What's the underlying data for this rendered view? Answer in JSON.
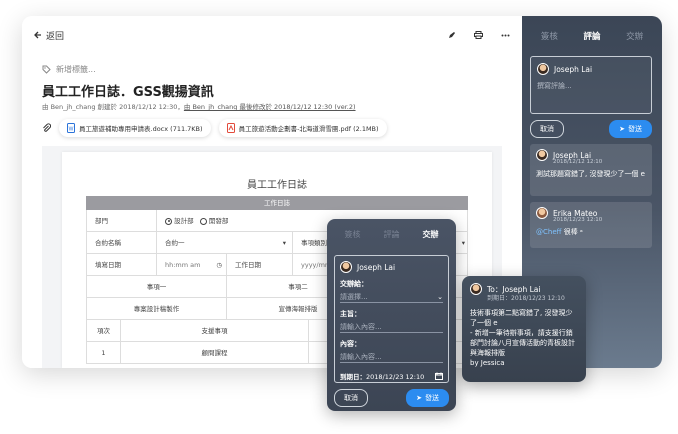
{
  "topbar": {
    "back_label": "返回"
  },
  "doc_header": {
    "tag_placeholder": "新增標籤...",
    "title": "員工工作日誌．GSS觀揚資訊",
    "meta_prefix": "由 Ben_jh_chang 創建於 2018/12/12 12:30，",
    "meta_link": "由 Ben_jh_chang 最後修改於 2018/12/12 12:30 (ver.2)"
  },
  "attachments": [
    {
      "name": "員工旅遊補助專用申請表.docx (711.7KB)",
      "type": "word"
    },
    {
      "name": "員工旅遊活動企劃書-北海道滑雪團.pdf (2.1MB)",
      "type": "pdf"
    }
  ],
  "form": {
    "title": "員工工作日誌",
    "bar": "工作日誌",
    "dept_label": "部門",
    "dept_opt1": "設計部",
    "dept_opt2": "開發部",
    "contract_label": "合約名稱",
    "contract_value": "合約一",
    "category_label": "事項類別",
    "date_label": "填寫日期",
    "time_value": "hh:mm am",
    "workdate_label": "工作日期",
    "workdate_value": "yyyy/mm/dd",
    "item1": "事項一",
    "item2": "事項二",
    "item1_val": "專案設計稿製作",
    "item2_val": "宣傳海報排版",
    "seq_label": "項次",
    "support_label": "支援事項",
    "seq_1": "1",
    "support_1": "顧問課程"
  },
  "side": {
    "tabs": [
      "簽核",
      "評論",
      "交辦"
    ],
    "active_tab": 1,
    "composer_user": "Joseph Lai",
    "composer_placeholder": "撰寫評論...",
    "cancel_label": "取消",
    "send_label": "發送",
    "comments": [
      {
        "user": "Joseph Lai",
        "time": "2018/12/12 12:10",
        "body": "測試那題寫錯了, 沒發現少了一個 e"
      },
      {
        "user": "Erika Mateo",
        "time": "2018/12/23 12:10",
        "mention": "@Cheff",
        "body": " 很棒 ॰"
      }
    ]
  },
  "assign": {
    "tabs": [
      "簽核",
      "評論",
      "交辦"
    ],
    "active_tab": 2,
    "user": "Joseph Lai",
    "to_label": "交辦給：",
    "to_placeholder": "請選擇...",
    "subject_label": "主旨：",
    "subject_placeholder": "請輸入內容...",
    "content_label": "內容：",
    "content_placeholder": "請輸入內容...",
    "due_label": "到期日：",
    "due_value": "2018/12/23 12:10",
    "cancel_label": "取消",
    "send_label": "發送"
  },
  "task": {
    "to": "To：Joseph Lai",
    "due": "到期日：2018/12/23 12:10",
    "body": "技術事項第二點寫錯了, 沒發現少了一個 e",
    "detail": "- 新增一筆待辦事項，請支援行銷部門討論八月宣傳活動的青板設計與海報排版",
    "by": "by Jessica"
  }
}
